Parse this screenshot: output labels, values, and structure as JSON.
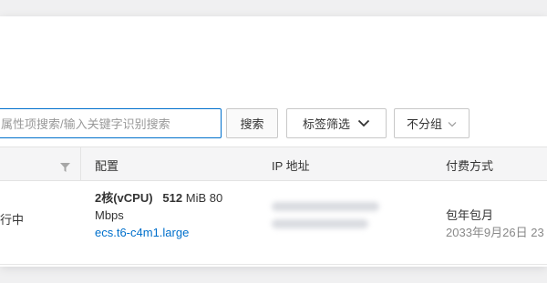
{
  "toolbar": {
    "search_placeholder": "属性项搜索/输入关键字识别搜索",
    "search_button": "搜索",
    "tag_filter_label": "标签筛选",
    "group_label": "不分组"
  },
  "table": {
    "headers": {
      "config": "配置",
      "ip": "IP 地址",
      "billing": "付费方式"
    },
    "rows": [
      {
        "status": "行中",
        "config_cpu": "2核(vCPU)",
        "config_memory": "512",
        "config_memory_unit": "MiB",
        "config_bandwidth_value": "80",
        "config_bandwidth_unit": "Mbps",
        "instance_spec": "ecs.t6-c4m1.large",
        "billing_type": "包年包月",
        "billing_date": "2033年9月26日 23"
      }
    ]
  },
  "colors": {
    "accent": "#0070cc",
    "header_bg": "#f5f5f6",
    "page_bg": "#f0f0f1"
  },
  "icons": [
    "filter-icon",
    "chevron-down-icon"
  ]
}
